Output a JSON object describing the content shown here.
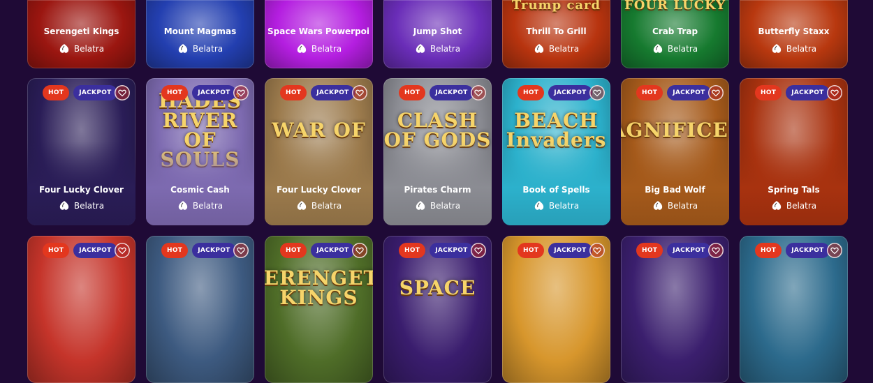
{
  "badges": {
    "hot": "HOT",
    "jackpot": "JACKPOT"
  },
  "provider": "Belatra",
  "row1": [
    {
      "name": "Serengeti Kings",
      "art": "",
      "color": "#9b1610"
    },
    {
      "name": "Mount Magmas",
      "art": "",
      "color": "#233fb0"
    },
    {
      "name": "Space Wars Powerpoints",
      "art": "",
      "color": "#b41ee0"
    },
    {
      "name": "Jump Shot",
      "art": "",
      "color": "#6a2db8"
    },
    {
      "name": "Thrill To Grill",
      "art": "Trump card",
      "color": "#b8340f"
    },
    {
      "name": "Crab Trap",
      "art": "FOUR LUCKY",
      "color": "#167a2f"
    },
    {
      "name": "Butterfly Staxx",
      "art": "",
      "color": "#b8380f"
    }
  ],
  "row2": [
    {
      "name": "Four Lucky Clover",
      "art": "",
      "color": "#2a1d57"
    },
    {
      "name": "Cosmic Cash",
      "art": "HADES RIVER OF SOULS",
      "color": "#7d6ab0"
    },
    {
      "name": "Four Lucky Clover",
      "art": "WAR OF",
      "color": "#9b7a4c"
    },
    {
      "name": "Pirates Charm",
      "art": "CLASH OF GODS",
      "color": "#8b8c93"
    },
    {
      "name": "Book of Spells",
      "art": "BEACH Invaders",
      "color": "#2cb1cc"
    },
    {
      "name": "Big Bad Wolf",
      "art": "MAGNIFICENT",
      "color": "#a55a1b"
    },
    {
      "name": "Spring Tals",
      "art": "",
      "color": "#a8320f"
    }
  ],
  "row3": [
    {
      "art": "",
      "color": "#c5342a"
    },
    {
      "art": "",
      "color": "#3d5a80"
    },
    {
      "art": "SERENGETI KINGS",
      "color": "#4f6d28"
    },
    {
      "art": "SPACE",
      "color": "#3a1d6e"
    },
    {
      "art": "",
      "color": "#d7962c"
    },
    {
      "art": "",
      "color": "#3b1f6e"
    },
    {
      "art": "",
      "color": "#2c6a8c"
    }
  ]
}
